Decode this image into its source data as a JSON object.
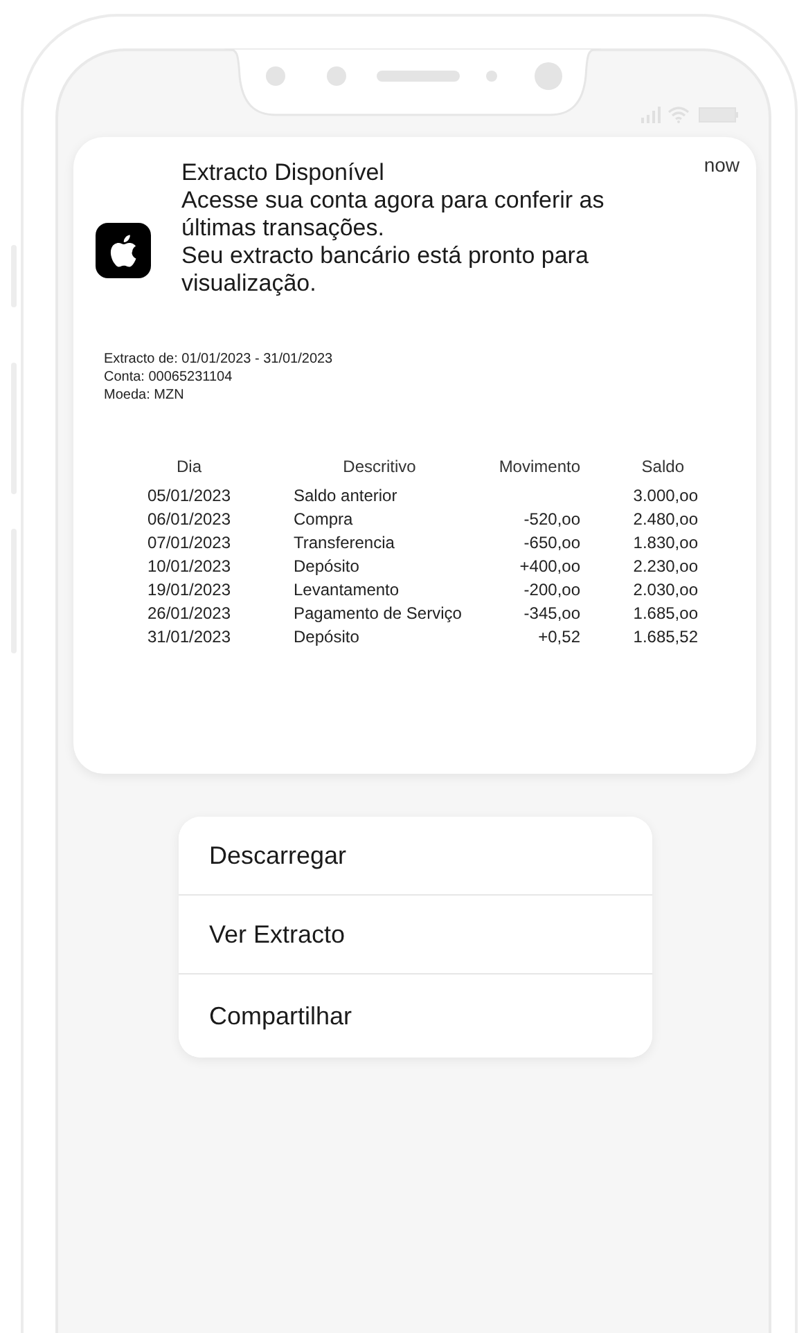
{
  "notification": {
    "title": "Extracto Disponível",
    "time": "now",
    "body": [
      "Acesse sua conta agora para conferir as últimas transações.",
      "Seu extracto bancário está pronto para visualização."
    ]
  },
  "statement": {
    "info": [
      "Extracto de: 01/01/2023 - 31/01/2023",
      "Conta:  00065231104",
      "Moeda: MZN"
    ],
    "columns": [
      "Dia",
      "Descritivo",
      "Movimento",
      "Saldo"
    ],
    "rows": [
      {
        "dia": "05/01/2023",
        "descritivo": "Saldo anterior",
        "saldo": "3.000,oo"
      },
      {
        "dia": "06/01/2023",
        "descritivo": "Compra",
        "movimento": "-520,oo",
        "saldo": "2.480,oo"
      },
      {
        "dia": "07/01/2023",
        "descritivo": "Transferencia",
        "movimento": "-650,oo",
        "saldo": "1.830,oo"
      },
      {
        "dia": "10/01/2023",
        "descritivo": "Depósito",
        "movimento": "+400,oo",
        "saldo": "2.230,oo"
      },
      {
        "dia": "19/01/2023",
        "descritivo": "Levantamento",
        "movimento": "-200,oo",
        "saldo": "2.030,oo"
      },
      {
        "dia": "26/01/2023",
        "descritivo": "Pagamento de Serviço",
        "movimento": "-345,oo",
        "saldo": "1.685,oo"
      },
      {
        "dia": "31/01/2023",
        "descritivo": "Depósito",
        "movimento": "+0,52",
        "saldo": "1.685,52"
      }
    ]
  },
  "actions": [
    "Descarregar",
    "Ver Extracto",
    "Compartilhar"
  ]
}
